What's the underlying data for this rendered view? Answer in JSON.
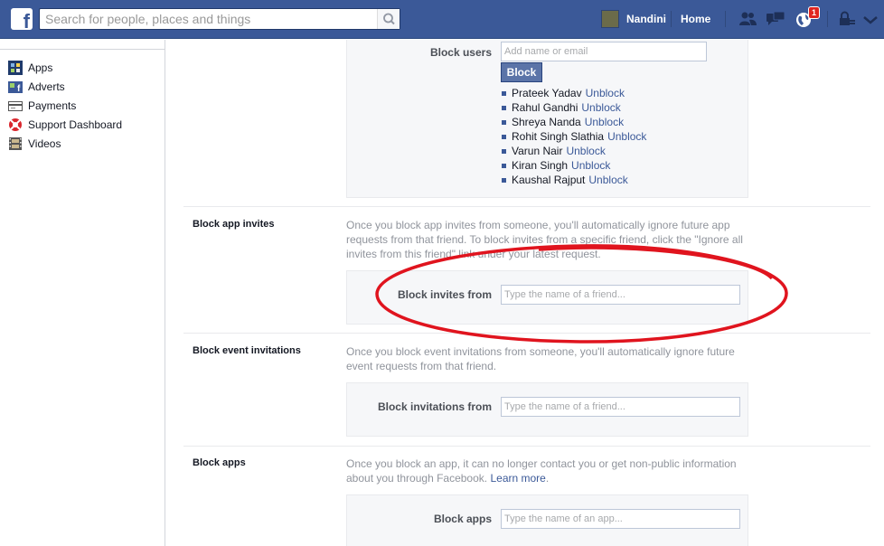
{
  "header": {
    "search_placeholder": "Search for people, places and things",
    "user_name": "Nandini",
    "home_label": "Home",
    "notification_count": "1",
    "brand_color": "#3b5998"
  },
  "sidebar": {
    "items": [
      {
        "label": "Apps",
        "icon": "apps-icon"
      },
      {
        "label": "Adverts",
        "icon": "adverts-icon"
      },
      {
        "label": "Payments",
        "icon": "payments-icon"
      },
      {
        "label": "Support Dashboard",
        "icon": "support-dashboard-icon"
      },
      {
        "label": "Videos",
        "icon": "videos-icon"
      }
    ]
  },
  "block_users": {
    "label": "Block users",
    "input_placeholder": "Add name or email",
    "button_label": "Block",
    "blocked": [
      {
        "name": "Prateek Yadav",
        "action": "Unblock"
      },
      {
        "name": "Rahul Gandhi",
        "action": "Unblock"
      },
      {
        "name": "Shreya Nanda",
        "action": "Unblock"
      },
      {
        "name": "Rohit Singh Slathia",
        "action": "Unblock"
      },
      {
        "name": "Varun Nair",
        "action": "Unblock"
      },
      {
        "name": "Kiran Singh",
        "action": "Unblock"
      },
      {
        "name": "Kaushal Rajput",
        "action": "Unblock"
      }
    ]
  },
  "block_app_invites": {
    "title": "Block app invites",
    "description": "Once you block app invites from someone, you'll automatically ignore future app requests from that friend. To block invites from a specific friend, click the \"Ignore all invites from this friend\" link under your latest request.",
    "field_label": "Block invites from",
    "input_placeholder": "Type the name of a friend..."
  },
  "block_event_invitations": {
    "title": "Block event invitations",
    "description": "Once you block event invitations from someone, you'll automatically ignore future event requests from that friend.",
    "field_label": "Block invitations from",
    "input_placeholder": "Type the name of a friend..."
  },
  "block_apps": {
    "title": "Block apps",
    "description": "Once you block an app, it can no longer contact you or get non-public information about you through Facebook.",
    "learn_more": "Learn more",
    "field_label": "Block apps",
    "input_placeholder": "Type the name of an app..."
  },
  "annotation": {
    "color": "#e0141e"
  }
}
